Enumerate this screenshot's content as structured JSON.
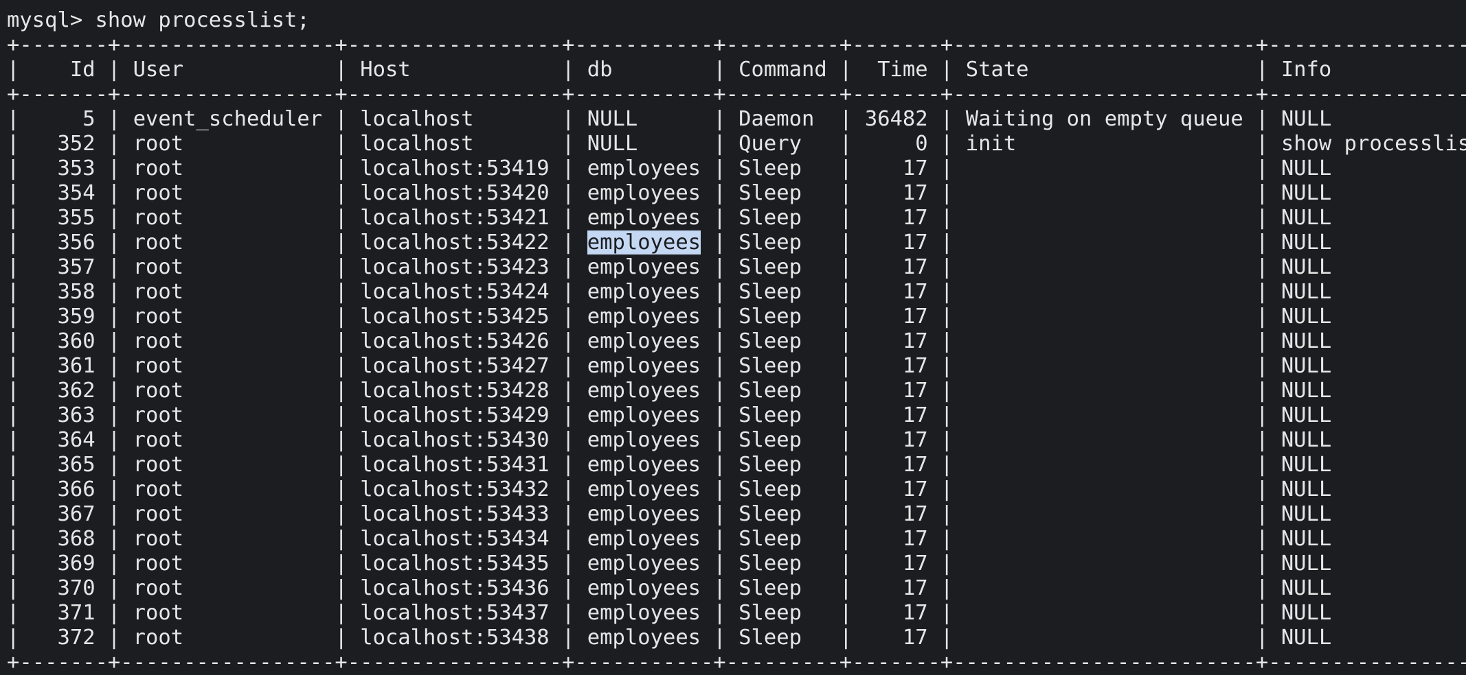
{
  "terminal": {
    "prompt": "mysql> ",
    "command": "show processlist;",
    "colors": {
      "background": "#1b1d21",
      "foreground": "#e6e6e6",
      "selection": "#c5d8f3"
    }
  },
  "table": {
    "columns": [
      {
        "label": "Id",
        "width": 5,
        "align": "right"
      },
      {
        "label": "User",
        "width": 15,
        "align": "left"
      },
      {
        "label": "Host",
        "width": 15,
        "align": "left"
      },
      {
        "label": "db",
        "width": 9,
        "align": "left"
      },
      {
        "label": "Command",
        "width": 7,
        "align": "left"
      },
      {
        "label": "Time",
        "width": 5,
        "align": "right"
      },
      {
        "label": "State",
        "width": 22,
        "align": "left"
      },
      {
        "label": "Info",
        "width": 16,
        "align": "left"
      }
    ],
    "selected_cell": {
      "row": 5,
      "col": 3
    },
    "rows": [
      [
        "5",
        "event_scheduler",
        "localhost",
        "NULL",
        "Daemon",
        "36482",
        "Waiting on empty queue",
        "NULL"
      ],
      [
        "352",
        "root",
        "localhost",
        "NULL",
        "Query",
        "0",
        "init",
        "show processlist"
      ],
      [
        "353",
        "root",
        "localhost:53419",
        "employees",
        "Sleep",
        "17",
        "",
        "NULL"
      ],
      [
        "354",
        "root",
        "localhost:53420",
        "employees",
        "Sleep",
        "17",
        "",
        "NULL"
      ],
      [
        "355",
        "root",
        "localhost:53421",
        "employees",
        "Sleep",
        "17",
        "",
        "NULL"
      ],
      [
        "356",
        "root",
        "localhost:53422",
        "employees",
        "Sleep",
        "17",
        "",
        "NULL"
      ],
      [
        "357",
        "root",
        "localhost:53423",
        "employees",
        "Sleep",
        "17",
        "",
        "NULL"
      ],
      [
        "358",
        "root",
        "localhost:53424",
        "employees",
        "Sleep",
        "17",
        "",
        "NULL"
      ],
      [
        "359",
        "root",
        "localhost:53425",
        "employees",
        "Sleep",
        "17",
        "",
        "NULL"
      ],
      [
        "360",
        "root",
        "localhost:53426",
        "employees",
        "Sleep",
        "17",
        "",
        "NULL"
      ],
      [
        "361",
        "root",
        "localhost:53427",
        "employees",
        "Sleep",
        "17",
        "",
        "NULL"
      ],
      [
        "362",
        "root",
        "localhost:53428",
        "employees",
        "Sleep",
        "17",
        "",
        "NULL"
      ],
      [
        "363",
        "root",
        "localhost:53429",
        "employees",
        "Sleep",
        "17",
        "",
        "NULL"
      ],
      [
        "364",
        "root",
        "localhost:53430",
        "employees",
        "Sleep",
        "17",
        "",
        "NULL"
      ],
      [
        "365",
        "root",
        "localhost:53431",
        "employees",
        "Sleep",
        "17",
        "",
        "NULL"
      ],
      [
        "366",
        "root",
        "localhost:53432",
        "employees",
        "Sleep",
        "17",
        "",
        "NULL"
      ],
      [
        "367",
        "root",
        "localhost:53433",
        "employees",
        "Sleep",
        "17",
        "",
        "NULL"
      ],
      [
        "368",
        "root",
        "localhost:53434",
        "employees",
        "Sleep",
        "17",
        "",
        "NULL"
      ],
      [
        "369",
        "root",
        "localhost:53435",
        "employees",
        "Sleep",
        "17",
        "",
        "NULL"
      ],
      [
        "370",
        "root",
        "localhost:53436",
        "employees",
        "Sleep",
        "17",
        "",
        "NULL"
      ],
      [
        "371",
        "root",
        "localhost:53437",
        "employees",
        "Sleep",
        "17",
        "",
        "NULL"
      ],
      [
        "372",
        "root",
        "localhost:53438",
        "employees",
        "Sleep",
        "17",
        "",
        "NULL"
      ]
    ]
  }
}
